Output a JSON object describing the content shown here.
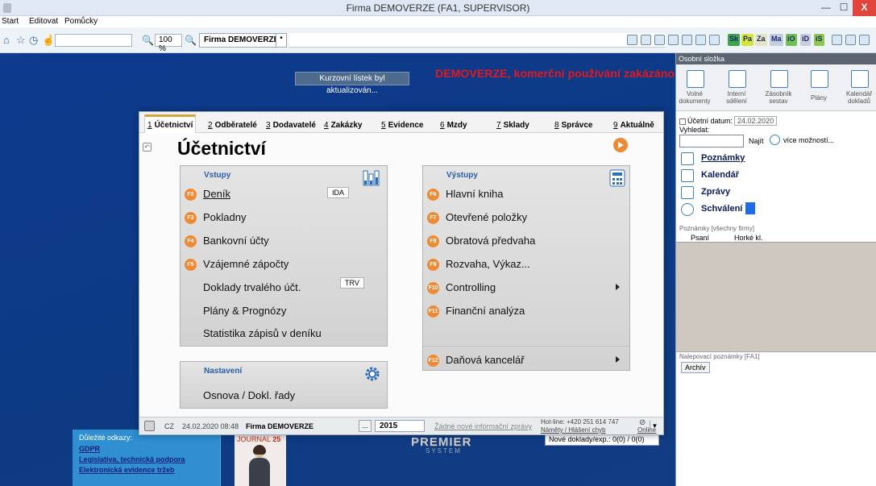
{
  "window": {
    "title": "Firma DEMOVERZE (FA1, SUPERVISOR)",
    "close_glyph": "X"
  },
  "menu": [
    "Start",
    "Editovat",
    "Pomůcky"
  ],
  "toolbar": {
    "zoom": "100 %",
    "firm_tab": "Firma DEMOVERZE",
    "tab_add": "•",
    "modules": [
      {
        "label": "Sk",
        "color": "#3fa34d"
      },
      {
        "label": "Pa",
        "color": "#d5e33a"
      },
      {
        "label": "Za",
        "color": "#e7e4c3"
      },
      {
        "label": "Ma",
        "color": "#c5cde0"
      },
      {
        "label": "iO",
        "color": "#6fbf51"
      },
      {
        "label": "iD",
        "color": "#c9cfe0"
      },
      {
        "label": "iS",
        "color": "#8fc64f"
      }
    ]
  },
  "desktop": {
    "toast": "Kurzovní lístek byl aktualizován...",
    "banner": "DEMOVERZE, komerční používání zakázáno",
    "links": {
      "heading": "Důležité odkazy:",
      "items": [
        "GDPR",
        "Legislativa, technická podpora",
        "Elektronická evidence tržeb"
      ]
    },
    "journal": {
      "name": "JOURNAL",
      "number": "25"
    },
    "logo": {
      "top": "PREMIER",
      "bottom": "SYSTEM"
    },
    "new_docs": "Nové doklady/exp.: 0(0) / 0(0)"
  },
  "tabs": [
    {
      "num": "1",
      "label": "Účetnictví"
    },
    {
      "num": "2",
      "label": "Odběratelé"
    },
    {
      "num": "3",
      "label": "Dodavatelé"
    },
    {
      "num": "4",
      "label": "Zakázky"
    },
    {
      "num": "5",
      "label": "Evidence"
    },
    {
      "num": "6",
      "label": "Mzdy"
    },
    {
      "num": "7",
      "label": "Sklady"
    },
    {
      "num": "8",
      "label": "Správce"
    },
    {
      "num": "9",
      "label": "Aktuálně"
    }
  ],
  "page": {
    "title": "Účetnictví",
    "inputs": {
      "title": "Vstupy",
      "items": [
        {
          "key": "F2",
          "label": "Deník",
          "underline": true
        },
        {
          "key": "F3",
          "label": "Pokladny"
        },
        {
          "key": "F4",
          "label": "Bankovní účty"
        },
        {
          "key": "F5",
          "label": "Vzájemné zápočty"
        },
        {
          "key": "",
          "label": "Doklady trvalého účt."
        },
        {
          "key": "",
          "label": "Plány & Prognózy"
        },
        {
          "key": "",
          "label": "Statistika zápisů v deníku"
        }
      ],
      "tag_ida": "IDA",
      "tag_trv": "TRV"
    },
    "outputs": {
      "title": "Výstupy",
      "items": [
        {
          "key": "F6",
          "label": "Hlavní kniha"
        },
        {
          "key": "F7",
          "label": "Otevřené položky"
        },
        {
          "key": "F8",
          "label": "Obratová předvaha"
        },
        {
          "key": "F9",
          "label": "Rozvaha, Výkaz..."
        },
        {
          "key": "F10",
          "label": "Controlling"
        },
        {
          "key": "F11",
          "label": "Finanční analýza"
        },
        {
          "key": "F12",
          "label": "Daňová kancelář"
        }
      ]
    },
    "settings": {
      "title": "Nastavení",
      "item": "Osnova / Dokl. řady"
    }
  },
  "status": {
    "lang": "CZ",
    "datetime": "24.02.2020 08:48",
    "firm": "Firma DEMOVERZE",
    "dots": "...",
    "year": "2015",
    "messages": "Žádné nové informační zprávy",
    "hotline": "Hot-line: +420 251 614 747",
    "ideas": "Náměty / Hlášení chyb",
    "online": "Online"
  },
  "sidebar": {
    "title": "Osobní složka",
    "icons": [
      {
        "label": "Volné dokumenty"
      },
      {
        "label": "Interní sdělení"
      },
      {
        "label": "Zásobník sestav"
      },
      {
        "label": "Plány"
      },
      {
        "label": "Kalendář dokladů"
      }
    ],
    "date_label": "Účetní datum:",
    "date_value": "24.02.2020",
    "search_label": "Vyhledat:",
    "find": "Najít",
    "more": "více možností...",
    "links": [
      "Poznámky",
      "Kalendář",
      "Zprávy",
      "Schválení"
    ],
    "notes_head": "Poznámky [všechny firmy]",
    "notes_tabs": [
      "Psaní",
      "Horké kl."
    ],
    "sticky_head": "Nalepovací poznámky [FA1]",
    "archive": "Archív"
  }
}
